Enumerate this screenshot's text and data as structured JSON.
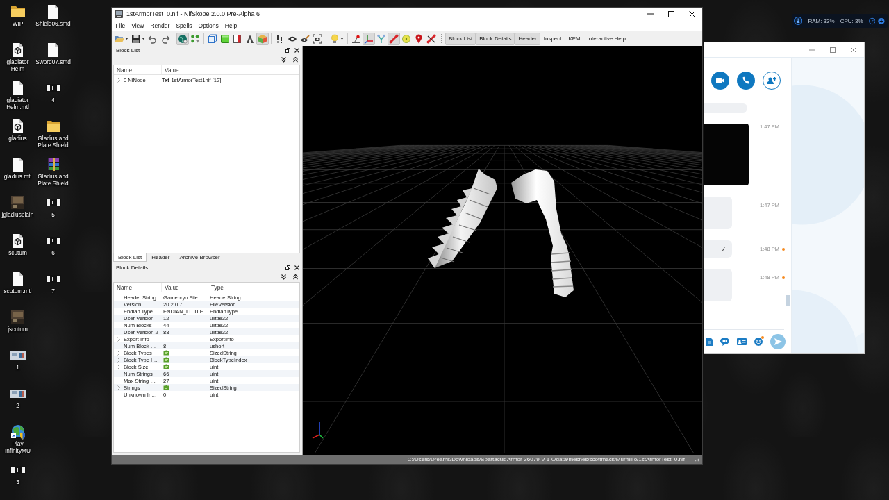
{
  "desktop": {
    "icons": [
      {
        "label": "WIP",
        "kind": "folder"
      },
      {
        "label": "gladiator Helm",
        "kind": "model"
      },
      {
        "label": "gladiator Helm.mtl",
        "kind": "file"
      },
      {
        "label": "gladius",
        "kind": "model"
      },
      {
        "label": "gladius.mtl",
        "kind": "file"
      },
      {
        "label": "jgladiusplain",
        "kind": "texture"
      },
      {
        "label": "scutum",
        "kind": "model"
      },
      {
        "label": "scutum.mtl",
        "kind": "file"
      },
      {
        "label": "jscutum",
        "kind": "texture"
      },
      {
        "label": "1",
        "kind": "photo"
      },
      {
        "label": "2",
        "kind": "photo"
      },
      {
        "label": "Play InfinityMU",
        "kind": "shortcut"
      },
      {
        "label": "3",
        "kind": "screenshot"
      },
      {
        "label": "Shield06.smd",
        "kind": "file"
      },
      {
        "label": "Sword07.smd",
        "kind": "file"
      },
      {
        "label": "4",
        "kind": "screenshot"
      },
      {
        "label": "Gladius and Plate Shield",
        "kind": "folder"
      },
      {
        "label": "Gladius and Plate Shield",
        "kind": "archive"
      },
      {
        "label": "5",
        "kind": "screenshot"
      },
      {
        "label": "6",
        "kind": "screenshot"
      },
      {
        "label": "7",
        "kind": "screenshot"
      }
    ]
  },
  "nifskope": {
    "title": "1stArmorTest_0.nif - NifSkope 2.0.0 Pre-Alpha 6",
    "menu": [
      "File",
      "View",
      "Render",
      "Spells",
      "Options",
      "Help"
    ],
    "toolbar": {
      "groups": [
        {
          "icons": [
            {
              "kind": "open",
              "selected": false
            },
            {
              "kind": "save",
              "selected": false
            },
            {
              "kind": "undo",
              "selected": false
            },
            {
              "kind": "redo",
              "selected": false
            }
          ]
        },
        {
          "icons": [
            {
              "kind": "globe",
              "selected": true
            },
            {
              "kind": "dots",
              "selected": false
            }
          ]
        },
        {
          "icons": [
            {
              "kind": "wirecube",
              "selected": false
            },
            {
              "kind": "solid",
              "selected": false
            },
            {
              "kind": "half",
              "selected": false
            },
            {
              "kind": "arch",
              "selected": false
            },
            {
              "kind": "shaded",
              "selected": true
            }
          ]
        },
        {
          "icons": [
            {
              "kind": "exclaim",
              "selected": false
            },
            {
              "kind": "eye",
              "selected": false
            },
            {
              "kind": "eyeedit",
              "selected": false
            },
            {
              "kind": "camera",
              "selected": false
            }
          ]
        },
        {
          "icons": [
            {
              "kind": "light",
              "selected": false
            }
          ]
        },
        {
          "icons": [
            {
              "kind": "vertex",
              "selected": false
            },
            {
              "kind": "axes",
              "selected": true
            },
            {
              "kind": "nodes",
              "selected": false
            },
            {
              "kind": "bone",
              "selected": true
            },
            {
              "kind": "sphere",
              "selected": false
            },
            {
              "kind": "pin",
              "selected": false
            },
            {
              "kind": "nobone",
              "selected": false
            }
          ]
        }
      ],
      "buttons": [
        {
          "label": "Block List",
          "selected": true
        },
        {
          "label": "Block Details",
          "selected": true
        },
        {
          "label": "Header",
          "selected": true
        },
        {
          "label": "Inspect",
          "selected": false
        },
        {
          "label": "KFM",
          "selected": false
        },
        {
          "label": "Interactive Help",
          "selected": false
        }
      ]
    },
    "block_list": {
      "title": "Block List",
      "columns": [
        "Name",
        "Value"
      ],
      "rows": [
        {
          "name": "0 NiNode",
          "tag": "Txt",
          "value": "1stArmorTest1nif [12]",
          "expandable": true
        }
      ]
    },
    "dock_tabs": [
      {
        "label": "Block List",
        "selected": true
      },
      {
        "label": "Header",
        "selected": false
      },
      {
        "label": "Archive Browser",
        "selected": false
      }
    ],
    "block_details": {
      "title": "Block Details",
      "columns": [
        "Name",
        "Value",
        "Type"
      ],
      "rows": [
        {
          "name": "Header String",
          "kind": "text",
          "value": "Gamebryo File …",
          "type": "HeaderString",
          "expandable": false
        },
        {
          "name": "Version",
          "kind": "text",
          "value": "20.2.0.7",
          "type": "FileVersion",
          "expandable": false
        },
        {
          "name": "Endian Type",
          "kind": "text",
          "value": "ENDIAN_LITTLE",
          "type": "EndianType",
          "expandable": false
        },
        {
          "name": "User Version",
          "kind": "text",
          "value": "12",
          "type": "ulittle32",
          "expandable": false
        },
        {
          "name": "Num Blocks",
          "kind": "text",
          "value": "44",
          "type": "ulittle32",
          "expandable": false
        },
        {
          "name": "User Version 2",
          "kind": "text",
          "value": "83",
          "type": "ulittle32",
          "expandable": false
        },
        {
          "name": "Export Info",
          "kind": "text",
          "type": "ExportInfo",
          "expandable": true
        },
        {
          "name": "Num Block …",
          "kind": "text",
          "value": "8",
          "type": "ushort",
          "expandable": false
        },
        {
          "name": "Block Types",
          "kind": "array",
          "type": "SizedString",
          "expandable": true
        },
        {
          "name": "Block Type I…",
          "kind": "array",
          "type": "BlockTypeIndex",
          "expandable": true
        },
        {
          "name": "Block Size",
          "kind": "array",
          "type": "uint",
          "expandable": true
        },
        {
          "name": "Num Strings",
          "kind": "text",
          "value": "66",
          "type": "uint",
          "expandable": false
        },
        {
          "name": "Max String …",
          "kind": "text",
          "value": "27",
          "type": "uint",
          "expandable": false
        },
        {
          "name": "Strings",
          "kind": "array",
          "type": "SizedString",
          "expandable": true
        },
        {
          "name": "Unknown In…",
          "kind": "text",
          "value": "0",
          "type": "uint",
          "expandable": false
        }
      ]
    },
    "status_bar": {
      "path": "C:/Users/Dreams/Downloads/Spartacus Armor-36079-V-1-0/data/meshes/scottmack/Murmillo/1stArmorTest_0.nif"
    }
  },
  "chat_window": {
    "actions": [
      {
        "kind": "video"
      },
      {
        "kind": "call"
      },
      {
        "kind": "add_contact"
      }
    ],
    "messages": [
      {
        "kind": "partial",
        "pending": false,
        "edited": false
      },
      {
        "kind": "image",
        "time": "1:47 PM",
        "pending": false,
        "edited": false
      },
      {
        "kind": "block",
        "time": "1:47 PM",
        "pending": false,
        "edited": false
      },
      {
        "kind": "line",
        "time": "1:48 PM",
        "pending": true,
        "edited": true
      },
      {
        "kind": "block",
        "time": "1:48 PM",
        "pending": true,
        "edited": false
      }
    ],
    "compose_tools": [
      {
        "kind": "file",
        "notification": false
      },
      {
        "kind": "video_message",
        "notification": false
      },
      {
        "kind": "contact",
        "notification": false
      },
      {
        "kind": "emoji",
        "notification": true
      },
      {
        "kind": "send",
        "notification": false
      }
    ]
  },
  "system_monitor": {
    "ram": "RAM: 33%",
    "cpu": "CPU: 3%"
  }
}
